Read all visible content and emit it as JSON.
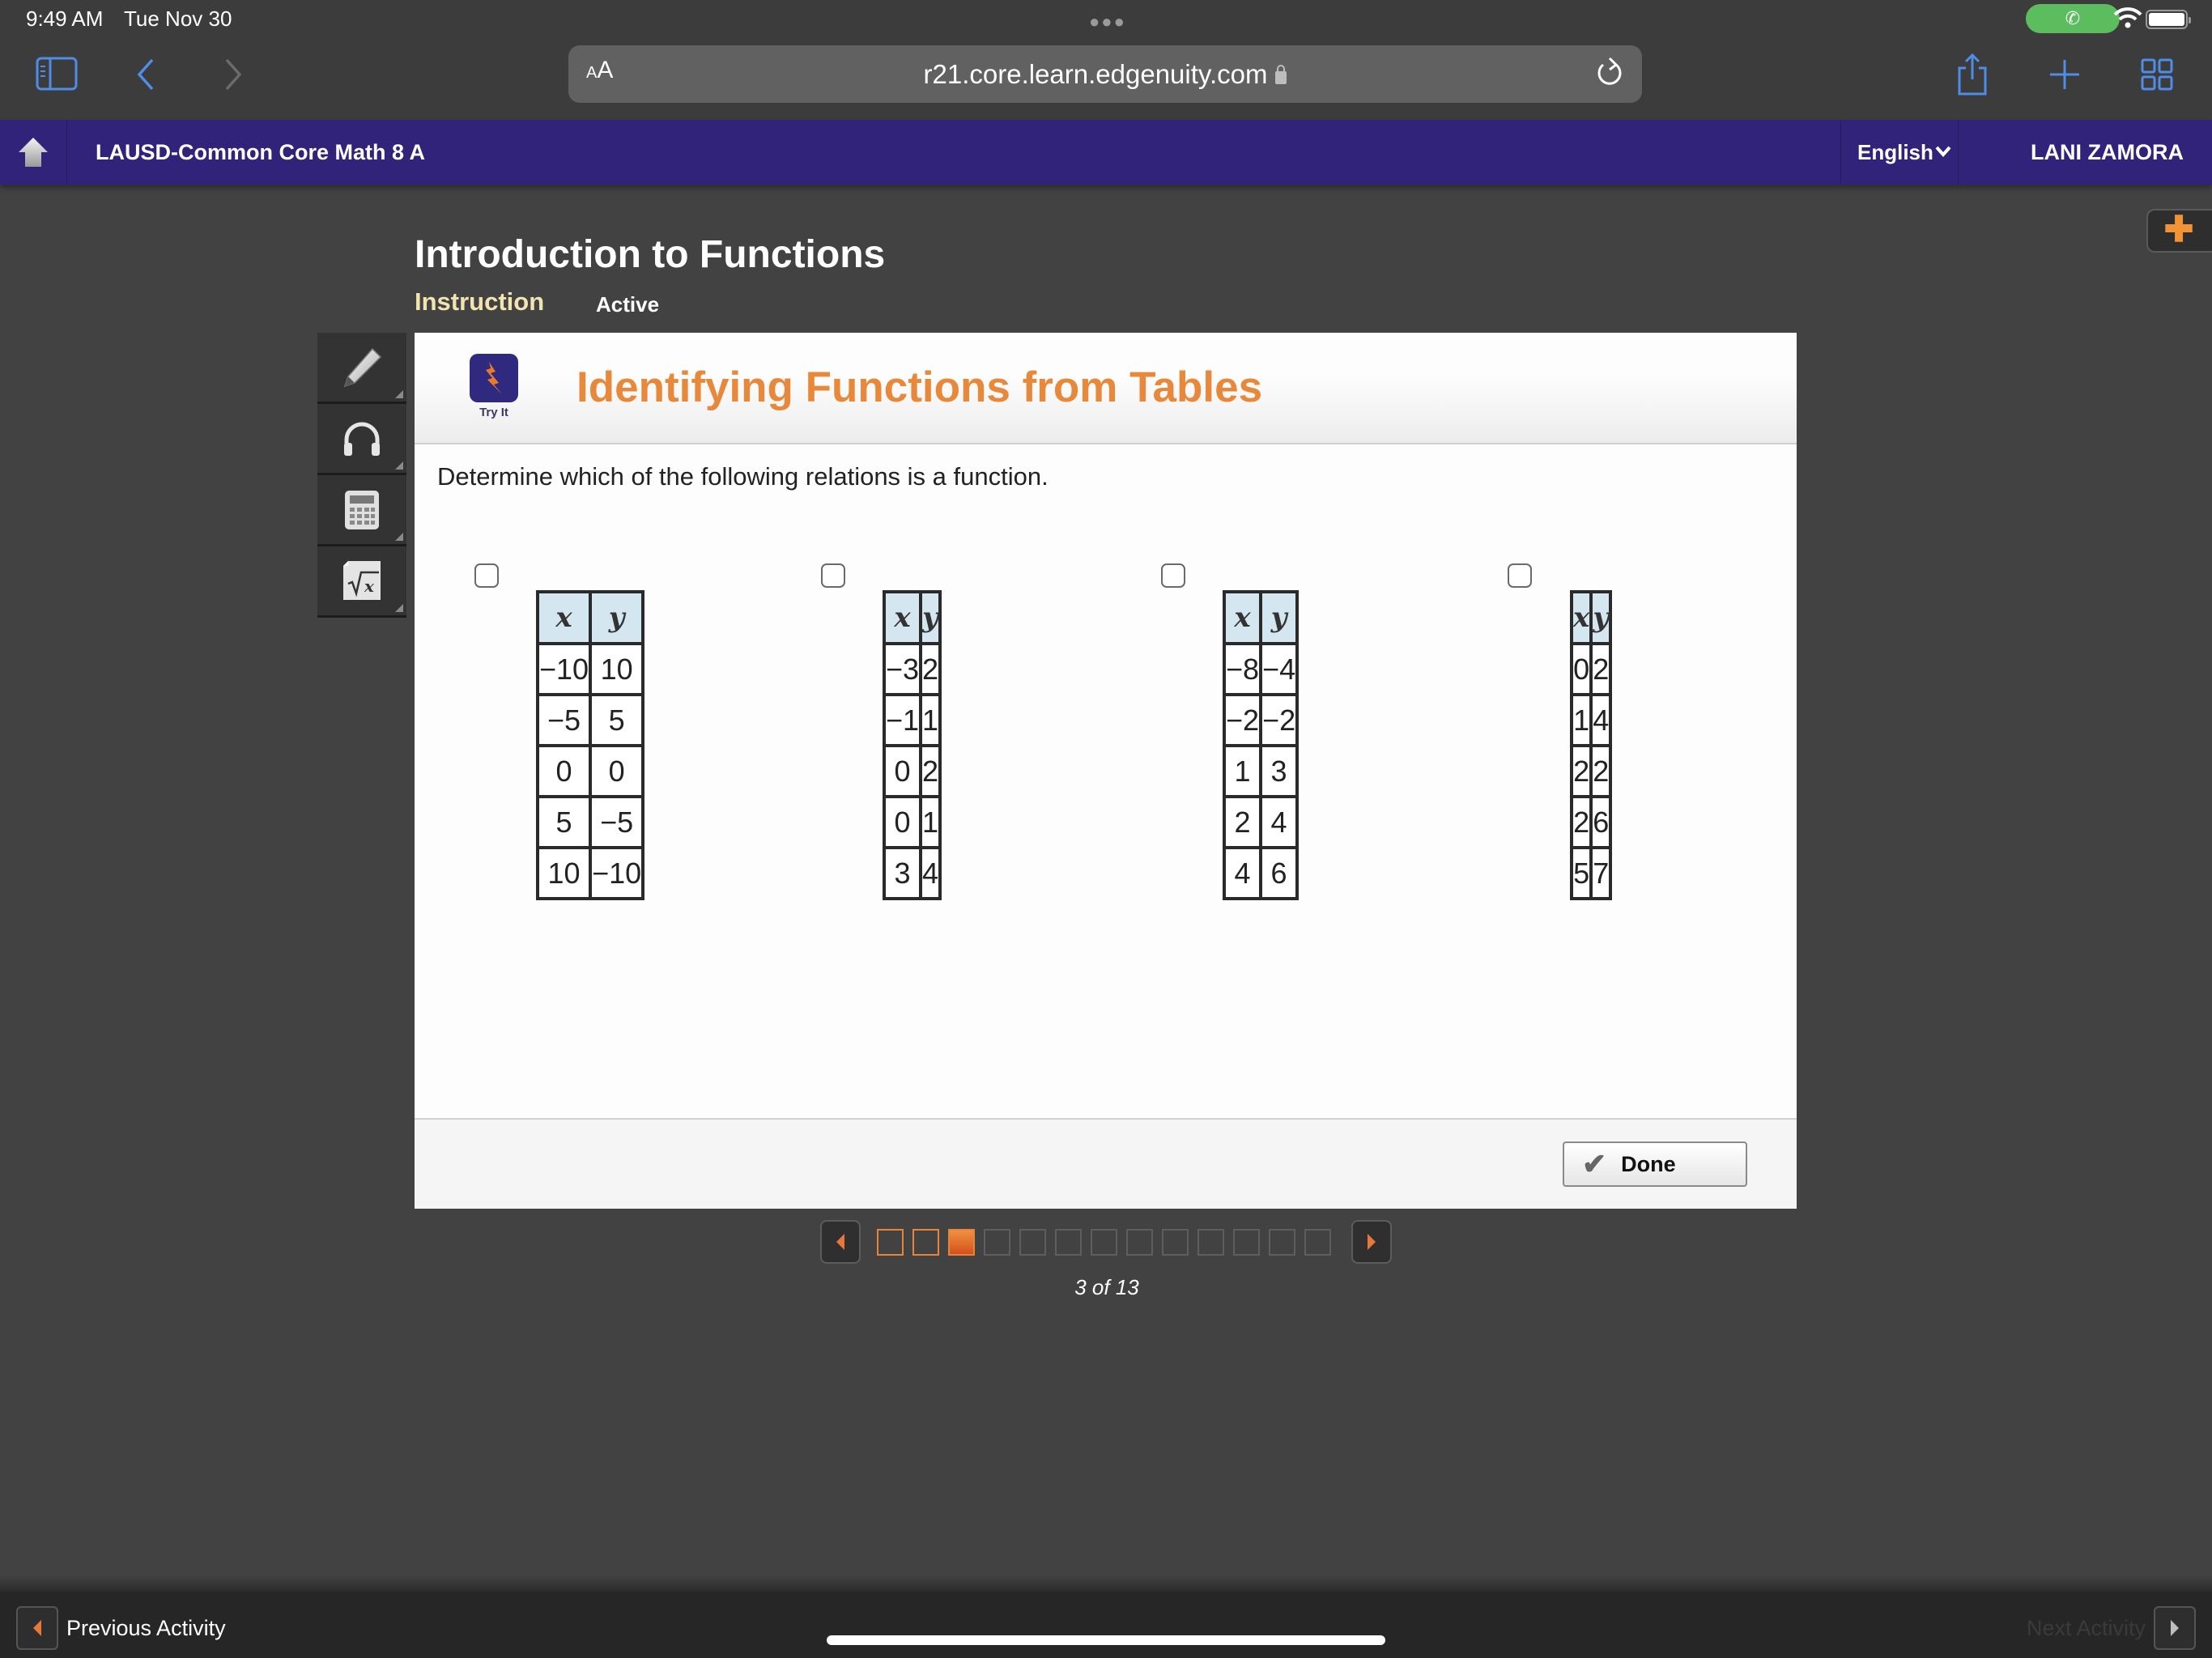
{
  "status_bar": {
    "time": "9:49 AM",
    "date": "Tue Nov 30"
  },
  "browser": {
    "url": "r21.core.learn.edgenuity.com",
    "reader_label": "AA",
    "icons": [
      "sidebar-icon",
      "back-icon",
      "forward-icon",
      "reload-icon",
      "share-icon",
      "new-tab-icon",
      "tabs-overview-icon"
    ]
  },
  "nav": {
    "course": "LAUSD-Common Core Math 8 A",
    "language": "English",
    "user": "LANI ZAMORA"
  },
  "lesson": {
    "title": "Introduction to Functions",
    "tabs": [
      {
        "label": "Instruction",
        "state": "selected"
      },
      {
        "label": "Active",
        "state": "normal"
      }
    ]
  },
  "tools": [
    "pencil-icon",
    "headphones-icon",
    "calculator-icon",
    "formula-icon"
  ],
  "activity": {
    "badge_label": "Try It",
    "title": "Identifying Functions from Tables",
    "prompt": "Determine which of the following relations is a function.",
    "choices": [
      {
        "headers": [
          "x",
          "y"
        ],
        "rows": [
          [
            "−10",
            "10"
          ],
          [
            "−5",
            "5"
          ],
          [
            "0",
            "0"
          ],
          [
            "5",
            "−5"
          ],
          [
            "10",
            "−10"
          ]
        ],
        "checked": false
      },
      {
        "headers": [
          "x",
          "y"
        ],
        "rows": [
          [
            "−3",
            "2"
          ],
          [
            "−1",
            "1"
          ],
          [
            "0",
            "2"
          ],
          [
            "0",
            "1"
          ],
          [
            "3",
            "4"
          ]
        ],
        "checked": false
      },
      {
        "headers": [
          "x",
          "y"
        ],
        "rows": [
          [
            "−8",
            "−4"
          ],
          [
            "−2",
            "−2"
          ],
          [
            "1",
            "3"
          ],
          [
            "2",
            "4"
          ],
          [
            "4",
            "6"
          ]
        ],
        "checked": false
      },
      {
        "headers": [
          "x",
          "y"
        ],
        "rows": [
          [
            "0",
            "2"
          ],
          [
            "1",
            "4"
          ],
          [
            "2",
            "2"
          ],
          [
            "2",
            "6"
          ],
          [
            "5",
            "7"
          ]
        ],
        "checked": false
      }
    ],
    "done_label": "Done"
  },
  "pagination": {
    "current": 3,
    "total": 13,
    "label": "3 of 13",
    "accent": "#e8833a"
  },
  "footer": {
    "previous_label": "Previous Activity",
    "next_label": "Next Activity"
  },
  "colors": {
    "nav_purple": "#32237a",
    "title_orange": "#e8883a",
    "instruction_cream": "#f3e3b0"
  }
}
